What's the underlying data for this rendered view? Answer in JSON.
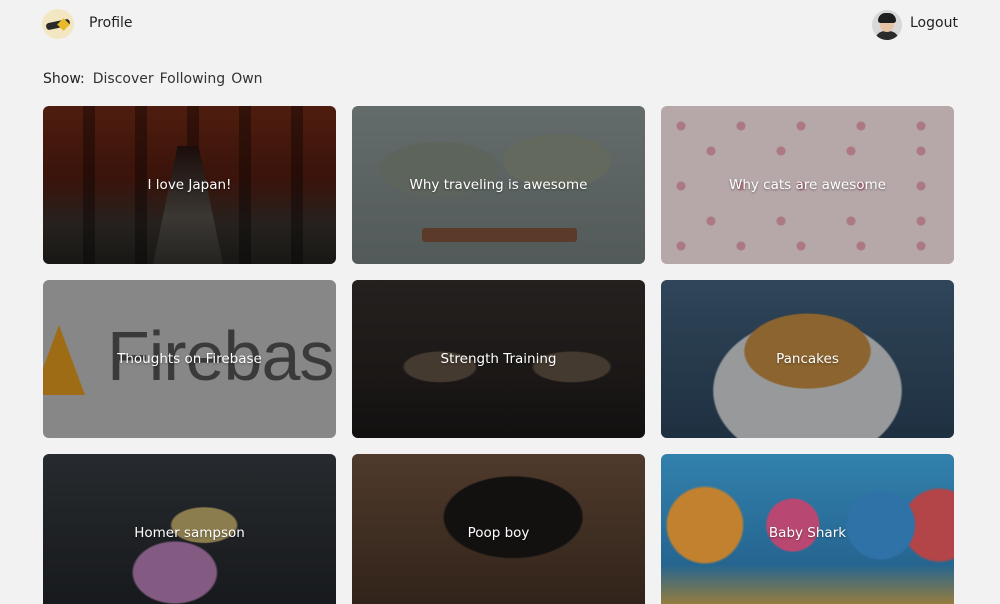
{
  "header": {
    "profile_label": "Profile",
    "logout_label": "Logout"
  },
  "filter": {
    "label": "Show:",
    "options": [
      "Discover",
      "Following",
      "Own"
    ]
  },
  "cards": [
    {
      "title": "I love Japan!"
    },
    {
      "title": "Why traveling is awesome"
    },
    {
      "title": "Why cats are awesome"
    },
    {
      "title": "Thoughts on Firebase"
    },
    {
      "title": "Strength Training"
    },
    {
      "title": "Pancakes"
    },
    {
      "title": "Homer sampson"
    },
    {
      "title": "Poop boy"
    },
    {
      "title": "Baby Shark"
    }
  ],
  "firebase_image_text": "Firebase",
  "colors": {
    "page_background": "#f2f2f2",
    "card_overlay": "rgba(0,0,0,0.35)",
    "card_title": "#ffffff"
  }
}
